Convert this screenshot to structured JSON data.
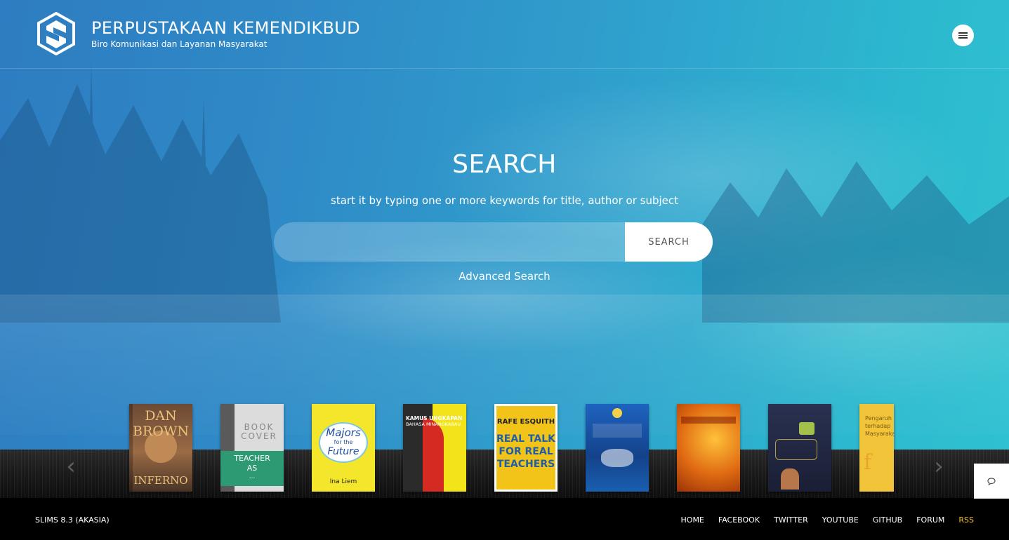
{
  "header": {
    "title": "PERPUSTAKAAN KEMENDIKBUD",
    "subtitle": "Biro Komunikasi dan Layanan Masyarakat",
    "menu_icon": "hamburger-icon"
  },
  "search": {
    "heading": "SEARCH",
    "hint": "start it by typing one or more keywords for title, author or subject",
    "input_value": "",
    "input_placeholder": "",
    "button_label": "SEARCH",
    "advanced_label": "Advanced Search"
  },
  "carousel": {
    "prev_icon": "chevron-left-icon",
    "next_icon": "chevron-right-icon",
    "books": [
      {
        "lines": [
          "DAN",
          "BROWN",
          "INFERNO"
        ],
        "bg": "#8a5a3c",
        "fg": "#e9c27a"
      },
      {
        "lines": [
          "BOOK",
          "COVER",
          "TEACHER",
          "AS",
          "..."
        ],
        "bg": "#d9d9d9",
        "fg": "#ffffff"
      },
      {
        "lines": [
          "Majors",
          "for the",
          "Future",
          "Ina Liem"
        ],
        "bg": "#f4e62a",
        "fg": "#1f4e9e"
      },
      {
        "lines": [
          "KAMUS UNGKAPAN",
          "BAHASA MINANGKABAU"
        ],
        "bg": "#f2e418",
        "fg": "#111111"
      },
      {
        "lines": [
          "RAFE ESQUITH",
          "REAL TALK",
          "FOR REAL",
          "TEACHERS"
        ],
        "bg": "#f2c318",
        "fg": "#1f5fa8"
      },
      {
        "lines": [],
        "bg": "#1e5fb8",
        "fg": "#ffffff"
      },
      {
        "lines": [],
        "bg": "#e8731e",
        "fg": "#ffffff"
      },
      {
        "lines": [],
        "bg": "#222c4a",
        "fg": "#f0d24a"
      },
      {
        "lines": [
          "Pengaruh Pers",
          "terhadap",
          "Masyarakat"
        ],
        "bg": "#f2c43a",
        "fg": "#7a5a12"
      }
    ]
  },
  "footer": {
    "version": "SLIMS 8.3 (AKASIA)",
    "links": [
      "HOME",
      "FACEBOOK",
      "TWITTER",
      "YOUTUBE",
      "GITHUB",
      "FORUM",
      "RSS"
    ]
  },
  "chat": {
    "icon": "chat-bubble-icon"
  },
  "colors": {
    "rss": "#f2c230",
    "hero_left": "#2e7cc1",
    "hero_right": "#2fc2d1"
  }
}
